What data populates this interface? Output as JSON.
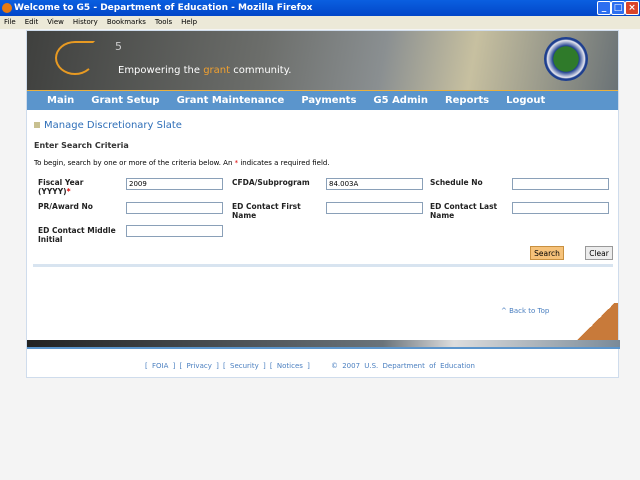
{
  "window": {
    "title": "Welcome to G5 - Department of Education - Mozilla Firefox"
  },
  "menu": [
    "File",
    "Edit",
    "View",
    "History",
    "Bookmarks",
    "Tools",
    "Help"
  ],
  "banner": {
    "logo_sup": "5",
    "tagline_pre": "Empowering the ",
    "tagline_hl": "grant",
    "tagline_post": " community."
  },
  "nav": [
    "Main",
    "Grant Setup",
    "Grant Maintenance",
    "Payments",
    "G5 Admin",
    "Reports",
    "Logout"
  ],
  "page": {
    "title": "Manage Discretionary Slate",
    "subtitle": "Enter Search Criteria",
    "intro_pre": "To begin, search by one or more of the criteria below. An ",
    "intro_star": "*",
    "intro_post": " indicates a required field."
  },
  "form": {
    "fiscal_year": {
      "label": "Fiscal Year (YYYY)",
      "star": "*",
      "value": "2009"
    },
    "cfda": {
      "label": "CFDA/Subprogram",
      "value": "84.003A"
    },
    "schedule": {
      "label": "Schedule No",
      "value": ""
    },
    "pr_award": {
      "label": "PR/Award No",
      "value": ""
    },
    "first_name": {
      "label": "ED Contact First Name",
      "value": ""
    },
    "last_name": {
      "label": "ED Contact Last Name",
      "value": ""
    },
    "middle": {
      "label": "ED Contact Middle Initial",
      "value": ""
    },
    "search": "Search",
    "clear": "Clear"
  },
  "back_to_top": "^ Back to Top",
  "footer": {
    "foia": "FOIA",
    "privacy": "Privacy",
    "security": "Security",
    "notices": "Notices",
    "copyright": "© 2007 U.S. Department of Education"
  }
}
